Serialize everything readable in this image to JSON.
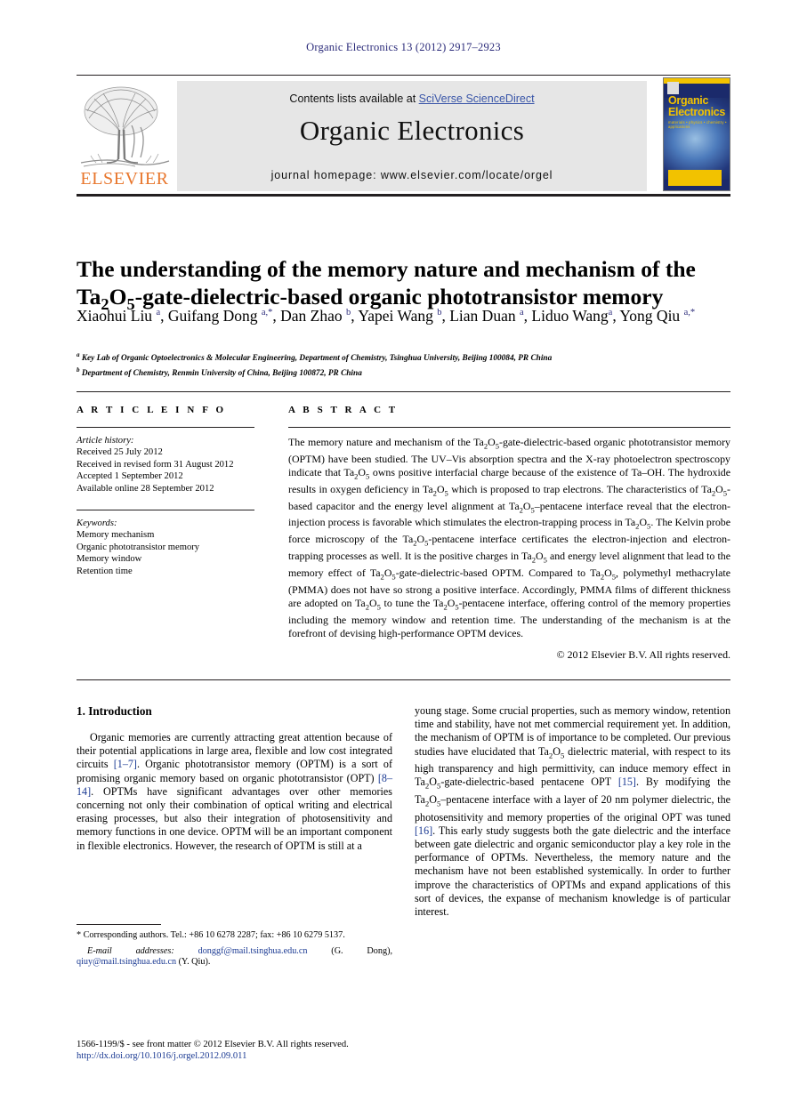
{
  "running_head": "Organic Electronics 13 (2012) 2917–2923",
  "masthead": {
    "contents_prefix": "Contents lists available at ",
    "contents_link": "SciVerse ScienceDirect",
    "journal_title": "Organic Electronics",
    "homepage": "journal homepage: www.elsevier.com/locate/orgel",
    "publisher_wordmark": "ELSEVIER",
    "cover": {
      "title_line1": "Organic",
      "title_line2": "Electronics",
      "subtitle": "materials • physics • chemistry • applications"
    }
  },
  "article": {
    "title_line1": "The understanding of the memory nature and mechanism of the",
    "title_line2_pre": "Ta",
    "title_line2": "O",
    "title_line2_post": "-gate-dielectric-based organic phototransistor memory",
    "authors": "Xiaohui Liu, Guifang Dong, Dan Zhao, Yapei Wang, Lian Duan, Liduo Wang, Yong Qiu",
    "affiliation_a": "Key Lab of Organic Optoelectronics & Molecular Engineering, Department of Chemistry, Tsinghua University, Beijing 100084, PR China",
    "affiliation_b": "Department of Chemistry, Renmin University of China, Beijing 100872, PR China"
  },
  "article_info": {
    "heading": "A R T I C L E    I N F O",
    "history_label": "Article history:",
    "history": [
      "Received 25 July 2012",
      "Received in revised form 31 August 2012",
      "Accepted 1 September 2012",
      "Available online 28 September 2012"
    ],
    "keywords_label": "Keywords:",
    "keywords": [
      "Memory mechanism",
      "Organic phototransistor memory",
      "Memory window",
      "Retention time"
    ]
  },
  "abstract": {
    "heading": "A B S T R A C T",
    "copyright": "© 2012 Elsevier B.V. All rights reserved."
  },
  "introduction": {
    "heading": "1. Introduction"
  },
  "footnote": {
    "corresponding": "Corresponding authors. Tel.: +86 10 6278 2287; fax: +86 10 6279 5137.",
    "email_label": "E-mail addresses:",
    "email1": "donggf@mail.tsinghua.edu.cn",
    "email1_owner": "(G. Dong),",
    "email2": "qiuy@mail.tsinghua.edu.cn",
    "email2_owner": "(Y. Qiu)."
  },
  "colophon": {
    "line1": "1566-1199/$ - see front matter © 2012 Elsevier B.V. All rights reserved.",
    "doi": "http://dx.doi.org/10.1016/j.orgel.2012.09.011"
  },
  "colors": {
    "link": "#1b3a93",
    "runhead": "#2b2b7a",
    "elsevier_orange": "#e8762c",
    "cover_yellow": "#f2c200",
    "cover_blue": "#1b2a6b"
  }
}
